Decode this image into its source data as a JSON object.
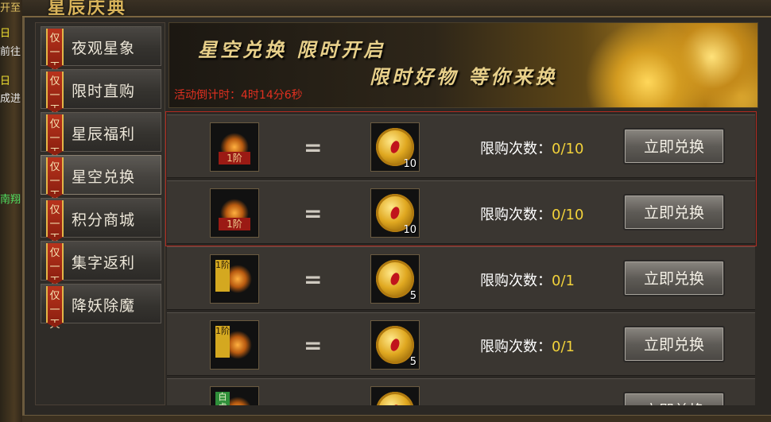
{
  "window": {
    "title": "星辰庆典"
  },
  "edge_texts": [
    "开至",
    "日",
    "前往",
    "日",
    "成进",
    "南翔"
  ],
  "sidebar": {
    "tag_text": "仅一天",
    "items": [
      {
        "label": "夜观星象",
        "active": false
      },
      {
        "label": "限时直购",
        "active": false
      },
      {
        "label": "星辰福利",
        "active": false
      },
      {
        "label": "星空兑换",
        "active": true
      },
      {
        "label": "积分商城",
        "active": false
      },
      {
        "label": "集字返利",
        "active": false
      },
      {
        "label": "降妖除魔",
        "active": false
      }
    ]
  },
  "banner": {
    "line1": "星空兑换 限时开启",
    "line2": "限时好物 等你来换",
    "countdown_label": "活动倒计时：",
    "countdown_value": "4时14分6秒"
  },
  "rows": [
    {
      "item_icon": "weapon-icon",
      "badge": "1阶",
      "badge_style": "band",
      "equals": "=",
      "cost_icon": "star-coin-icon",
      "cost": "10",
      "limit_label": "限购次数：",
      "limit_value": "0/10",
      "button": "立即兑换"
    },
    {
      "item_icon": "armor-icon",
      "badge": "1阶",
      "badge_style": "band",
      "equals": "=",
      "cost_icon": "star-coin-icon",
      "cost": "10",
      "limit_label": "限购次数：",
      "limit_value": "0/10",
      "button": "立即兑换"
    },
    {
      "item_icon": "weapon-icon",
      "badge": "1阶",
      "badge_style": "vertical",
      "equals": "=",
      "cost_icon": "star-coin-icon",
      "cost": "5",
      "limit_label": "限购次数：",
      "limit_value": "0/1",
      "button": "立即兑换"
    },
    {
      "item_icon": "armor-icon",
      "badge": "1阶",
      "badge_style": "vertical",
      "equals": "=",
      "cost_icon": "star-coin-icon",
      "cost": "5",
      "limit_label": "限购次数：",
      "limit_value": "0/1",
      "button": "立即兑换"
    },
    {
      "item_icon": "weapon-icon",
      "badge": "白虎",
      "badge_style": "green",
      "equals": "",
      "cost_icon": "star-coin-icon",
      "cost": "",
      "limit_label": "",
      "limit_value": "",
      "button": "立即兑换"
    }
  ],
  "colors": {
    "highlight_border": "#b02a20",
    "countdown": "#e03020",
    "limit_value": "#f2d23a"
  }
}
